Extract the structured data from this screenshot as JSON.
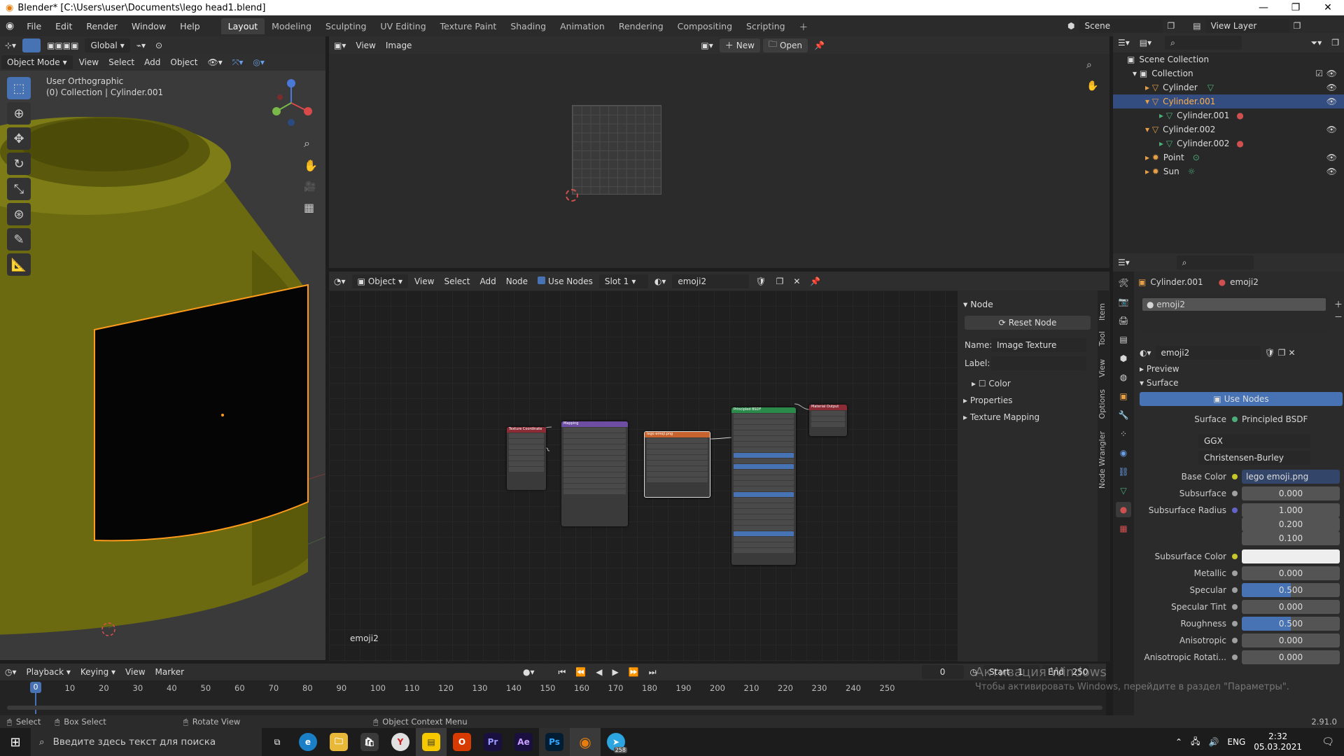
{
  "window": {
    "title": "Blender* [C:\\Users\\user\\Documents\\lego head1.blend]",
    "minimize": "—",
    "maximize": "❐",
    "close": "✕"
  },
  "menu": [
    "File",
    "Edit",
    "Render",
    "Window",
    "Help"
  ],
  "workspaces": [
    "Layout",
    "Modeling",
    "Sculpting",
    "UV Editing",
    "Texture Paint",
    "Shading",
    "Animation",
    "Rendering",
    "Compositing",
    "Scripting"
  ],
  "active_workspace": "Layout",
  "scene": {
    "scene_label": "Scene",
    "view_layer_label": "View Layer"
  },
  "viewport": {
    "mode": "Object Mode",
    "menus": [
      "View",
      "Select",
      "Add",
      "Object"
    ],
    "orientation": "Global",
    "overlay_title": "User Orthographic",
    "overlay_sub": "(0) Collection | Cylinder.001"
  },
  "image_editor": {
    "menus": [
      "View",
      "Image"
    ],
    "new_label": "New",
    "open_label": "Open"
  },
  "node_editor": {
    "type": "Object",
    "menus": [
      "View",
      "Select",
      "Add",
      "Node"
    ],
    "use_nodes": "Use Nodes",
    "slot": "Slot 1",
    "material": "emoji2",
    "corner_label": "emoji2",
    "nodes": {
      "tex_coord": "Texture Coordinate",
      "mapping": "Mapping",
      "image": "lego emoji.png",
      "bsdf": "Principled BSDF",
      "output": "Material Output"
    }
  },
  "node_sidebar": {
    "panel": "Node",
    "reset": "Reset Node",
    "name_label": "Name:",
    "name_value": "Image Texture",
    "label_label": "Label:",
    "color": "Color",
    "properties": "Properties",
    "texture_mapping": "Texture Mapping",
    "tabs": [
      "Item",
      "Tool",
      "View",
      "Options",
      "Node Wrangler"
    ]
  },
  "outliner": {
    "root": "Scene Collection",
    "items": [
      {
        "label": "Collection",
        "indent": 1
      },
      {
        "label": "Cylinder",
        "indent": 2
      },
      {
        "label": "Cylinder.001",
        "indent": 2,
        "selected": true
      },
      {
        "label": "Cylinder.001",
        "indent": 3
      },
      {
        "label": "Cylinder.002",
        "indent": 2
      },
      {
        "label": "Cylinder.002",
        "indent": 3
      },
      {
        "label": "Point",
        "indent": 2
      },
      {
        "label": "Sun",
        "indent": 2
      }
    ]
  },
  "properties": {
    "object": "Cylinder.001",
    "material": "emoji2",
    "slot_material": "emoji2",
    "datablock": "emoji2",
    "preview": "Preview",
    "surface_panel": "Surface",
    "use_nodes": "Use Nodes",
    "surface_label": "Surface",
    "surface_value": "Principled BSDF",
    "distribution": "GGX",
    "sss_method": "Christensen-Burley",
    "rows": [
      {
        "label": "Base Color",
        "value": "lego emoji.png",
        "kind": "link"
      },
      {
        "label": "Subsurface",
        "value": "0.000",
        "kind": "num"
      },
      {
        "label": "Subsurface Radius",
        "value": "1.000",
        "kind": "num"
      },
      {
        "label": "",
        "value": "0.200",
        "kind": "num"
      },
      {
        "label": "",
        "value": "0.100",
        "kind": "num"
      },
      {
        "label": "Subsurface Color",
        "value": "",
        "kind": "color"
      },
      {
        "label": "Metallic",
        "value": "0.000",
        "kind": "num"
      },
      {
        "label": "Specular",
        "value": "0.500",
        "kind": "slider"
      },
      {
        "label": "Specular Tint",
        "value": "0.000",
        "kind": "num"
      },
      {
        "label": "Roughness",
        "value": "0.500",
        "kind": "slider"
      },
      {
        "label": "Anisotropic",
        "value": "0.000",
        "kind": "num"
      },
      {
        "label": "Anisotropic Rotati...",
        "value": "0.000",
        "kind": "num"
      }
    ]
  },
  "timeline": {
    "menus": [
      "Playback",
      "Keying",
      "View",
      "Marker"
    ],
    "current": "0",
    "start_label": "Start",
    "start": "1",
    "end_label": "End",
    "end": "250",
    "ticks": [
      "0",
      "10",
      "20",
      "30",
      "40",
      "50",
      "60",
      "70",
      "80",
      "90",
      "100",
      "110",
      "120",
      "130",
      "140",
      "150",
      "160",
      "170",
      "180",
      "190",
      "200",
      "210",
      "220",
      "230",
      "240",
      "250"
    ]
  },
  "status": {
    "select": "Select",
    "box_select": "Box Select",
    "rotate": "Rotate View",
    "context": "Object Context Menu",
    "version": "2.91.0"
  },
  "activation": {
    "line1": "Активация Windows",
    "line2": "Чтобы активировать Windows, перейдите в раздел \"Параметры\"."
  },
  "taskbar": {
    "search": "Введите здесь текст для поиска",
    "lang": "ENG",
    "time": "2:32",
    "date": "05.03.2021",
    "badge": "258"
  }
}
